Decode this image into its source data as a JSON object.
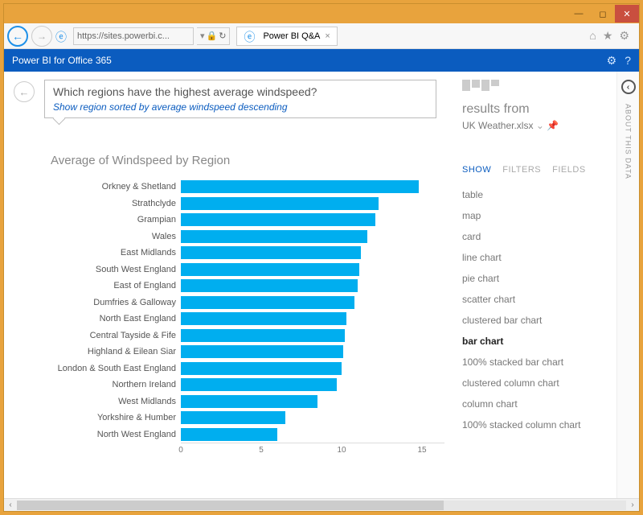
{
  "browser": {
    "url": "https://sites.powerbi.c...",
    "tab_title": "Power BI Q&A"
  },
  "app_title": "Power BI for Office 365",
  "query": {
    "text": "Which regions have the highest average windspeed?",
    "suggestion": "Show region sorted by average windspeed descending"
  },
  "chart_data": {
    "type": "bar",
    "title": "Average of Windspeed by Region",
    "xlabel": "",
    "ylabel": "",
    "xlim": [
      0,
      15
    ],
    "ticks": [
      0,
      5,
      10,
      15
    ],
    "categories": [
      "Orkney & Shetland",
      "Strathclyde",
      "Grampian",
      "Wales",
      "East Midlands",
      "South West England",
      "East of England",
      "Dumfries & Galloway",
      "North East England",
      "Central Tayside & Fife",
      "Highland & Eilean Siar",
      "London & South East England",
      "Northern Ireland",
      "West Midlands",
      "Yorkshire & Humber",
      "North West England"
    ],
    "values": [
      14.8,
      12.3,
      12.1,
      11.6,
      11.2,
      11.1,
      11.0,
      10.8,
      10.3,
      10.2,
      10.1,
      10.0,
      9.7,
      8.5,
      6.5,
      6.0
    ]
  },
  "results": {
    "heading": "results from",
    "source": "UK Weather.xlsx"
  },
  "viz_tabs": {
    "show": "SHOW",
    "filters": "FILTERS",
    "fields": "FIELDS"
  },
  "viz_options": [
    {
      "label": "table",
      "selected": false
    },
    {
      "label": "map",
      "selected": false
    },
    {
      "label": "card",
      "selected": false
    },
    {
      "label": "line chart",
      "selected": false
    },
    {
      "label": "pie chart",
      "selected": false
    },
    {
      "label": "scatter chart",
      "selected": false
    },
    {
      "label": "clustered bar chart",
      "selected": false
    },
    {
      "label": "bar chart",
      "selected": true
    },
    {
      "label": "100% stacked bar chart",
      "selected": false
    },
    {
      "label": "clustered column chart",
      "selected": false
    },
    {
      "label": "column chart",
      "selected": false
    },
    {
      "label": "100% stacked column chart",
      "selected": false
    }
  ],
  "side_label": "ABOUT THIS DATA"
}
